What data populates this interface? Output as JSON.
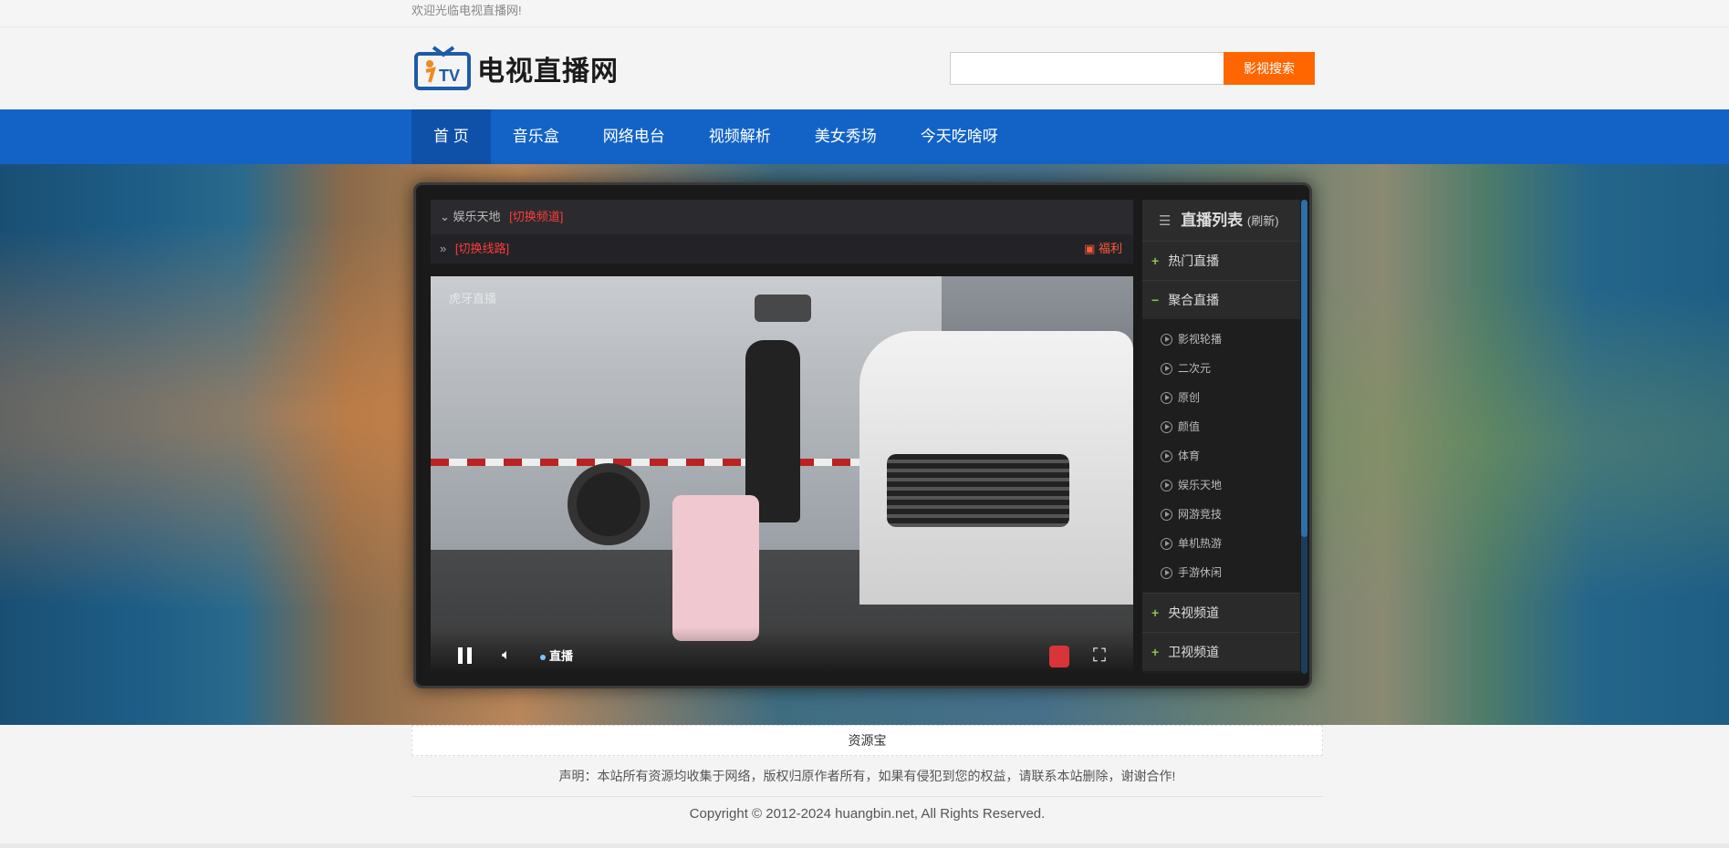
{
  "topbar": {
    "welcome": "欢迎光临电视直播网!"
  },
  "header": {
    "logo_text": "电视直播网",
    "logo_badge": "TV",
    "search_placeholder": "",
    "search_button": "影视搜索"
  },
  "nav": {
    "items": [
      "首 页",
      "音乐盒",
      "网络电台",
      "视频解析",
      "美女秀场",
      "今天吃啥呀"
    ]
  },
  "player": {
    "channel_name": "娱乐天地",
    "switch_channel": "[切换频道]",
    "switch_route": "[切换线路]",
    "welfare": "福利",
    "watermark": "虎牙直播",
    "live_label": "直播",
    "playlist": {
      "title": "直播列表",
      "refresh": "(刷新)",
      "groups": [
        {
          "label": "热门直播",
          "sign": "+"
        },
        {
          "label": "聚合直播",
          "sign": "−"
        }
      ],
      "sub_items": [
        "影视轮播",
        "二次元",
        "原创",
        "颜值",
        "体育",
        "娱乐天地",
        "网游竞技",
        "单机热游",
        "手游休闲"
      ],
      "groups_after": [
        {
          "label": "央视频道",
          "sign": "+"
        },
        {
          "label": "卫视频道",
          "sign": "+"
        }
      ]
    }
  },
  "footer": {
    "resource": "资源宝",
    "notice": "声明：本站所有资源均收集于网络，版权归原作者所有，如果有侵犯到您的权益，请联系本站删除，谢谢合作!",
    "copyright": "Copyright © 2012-2024 huangbin.net, All Rights Reserved."
  },
  "colors": {
    "nav_bg": "#1363c7",
    "search_button": "#ff6600",
    "switch_red": "#ff3b3b",
    "plus_green": "#8bc34a"
  }
}
